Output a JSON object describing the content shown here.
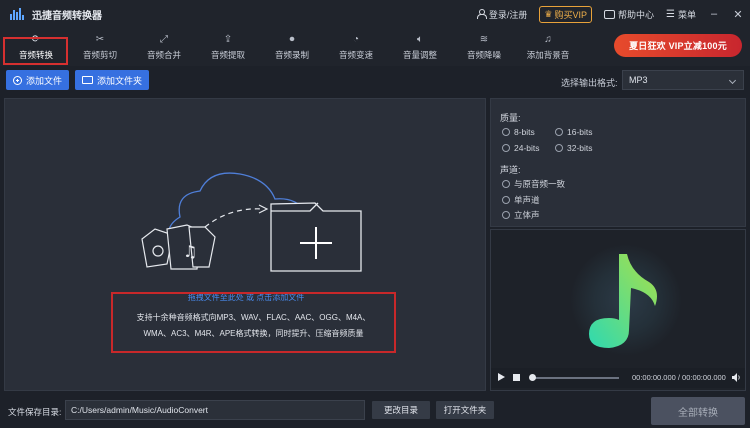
{
  "window": {
    "title": "迅捷音频转换器",
    "login_label": "登录/注册",
    "vip_label": "购买VIP",
    "help_label": "帮助中心",
    "menu_label": "菜单"
  },
  "toolbar": {
    "items": [
      {
        "label": "音频转换",
        "icon": "refresh-icon"
      },
      {
        "label": "音频剪切",
        "icon": "scissors-icon"
      },
      {
        "label": "音频合并",
        "icon": "merge-icon"
      },
      {
        "label": "音频提取",
        "icon": "extract-icon"
      },
      {
        "label": "音频录制",
        "icon": "microphone-icon"
      },
      {
        "label": "音频变速",
        "icon": "speed-icon"
      },
      {
        "label": "音量调整",
        "icon": "volume-icon"
      },
      {
        "label": "音频降噪",
        "icon": "noise-icon"
      },
      {
        "label": "添加背景音",
        "icon": "music-add-icon"
      }
    ],
    "promo_label": "夏日狂欢 VIP立减100元"
  },
  "actions": {
    "add_file_label": "添加文件",
    "add_folder_label": "添加文件夹",
    "format_label": "选择输出格式:",
    "format_value": "MP3"
  },
  "dropzone": {
    "hint_link": "拖拽文件至此处 或 点击添加文件",
    "desc_line1": "支持十余种音频格式向MP3、WAV、FLAC、AAC、OGG、M4A、",
    "desc_line2": "WMA、AC3、M4R、APE格式转换，同时提升、压缩音频质量"
  },
  "settings": {
    "quality_title": "质量:",
    "quality_options": [
      "8-bits",
      "16-bits",
      "24-bits",
      "32-bits"
    ],
    "channel_title": "声道:",
    "channel_options": [
      "与原音频一致",
      "单声道",
      "立体声"
    ]
  },
  "player": {
    "time_text": "00:00:00.000 / 00:00:00.000",
    "note_gradient": [
      "#2fd9b0",
      "#a8e04a"
    ]
  },
  "bottom": {
    "save_label": "文件保存目录:",
    "path_value": "C:/Users/admin/Music/AudioConvert",
    "change_dir_label": "更改目录",
    "open_folder_label": "打开文件夹",
    "convert_all_label": "全部转换"
  },
  "colors": {
    "accent": "#3670e0",
    "highlight_border": "#d63030",
    "promo": "#e74b2c",
    "link": "#4a8cf0"
  }
}
